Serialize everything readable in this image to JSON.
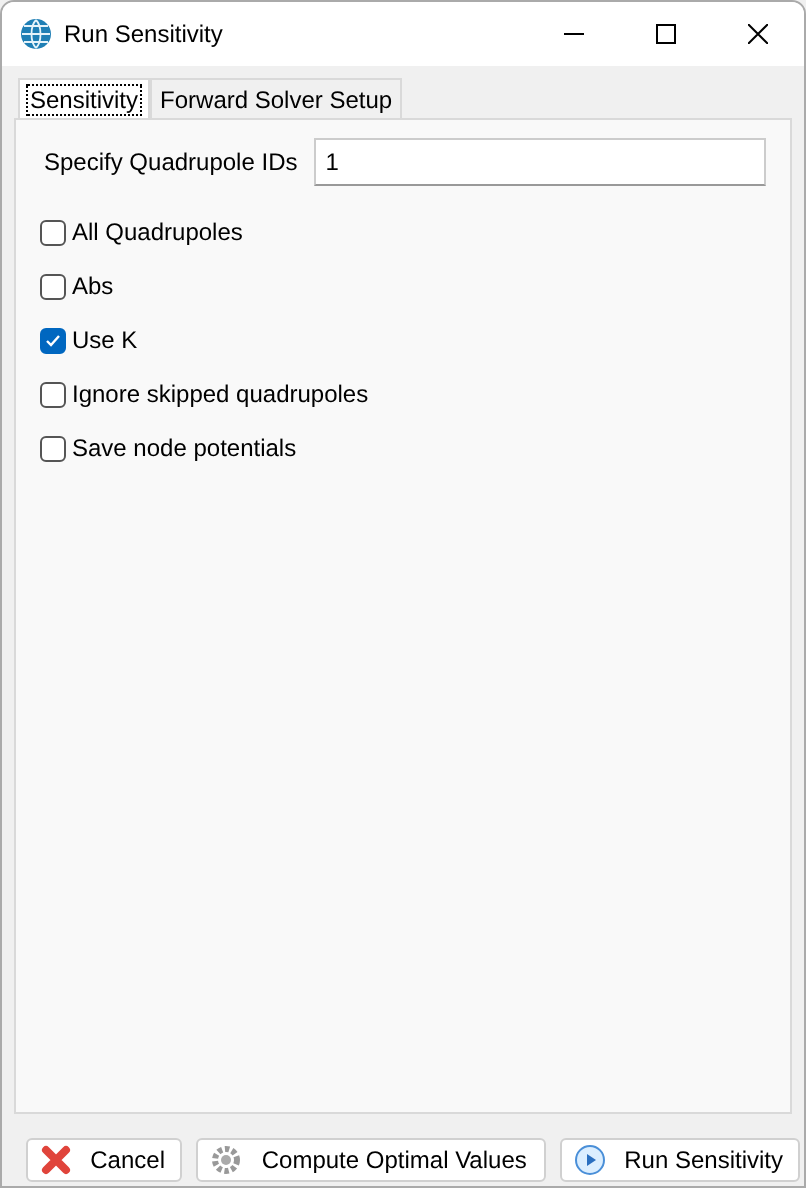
{
  "window": {
    "title": "Run Sensitivity"
  },
  "tabs": [
    {
      "label": "Sensitivity",
      "selected": true
    },
    {
      "label": "Forward Solver Setup",
      "selected": false
    }
  ],
  "quadrupole_ids": {
    "label": "Specify Quadrupole IDs",
    "value": "1"
  },
  "options": [
    {
      "label": "All Quadrupoles",
      "checked": false
    },
    {
      "label": "Abs",
      "checked": false
    },
    {
      "label": "Use K",
      "checked": true
    },
    {
      "label": "Ignore skipped quadrupoles",
      "checked": false
    },
    {
      "label": "Save node potentials",
      "checked": false
    }
  ],
  "buttons": [
    {
      "label": "Cancel",
      "kind": "cancel"
    },
    {
      "label": "Compute Optimal Values",
      "kind": "compute"
    },
    {
      "label": "Run Sensitivity",
      "kind": "run"
    }
  ]
}
